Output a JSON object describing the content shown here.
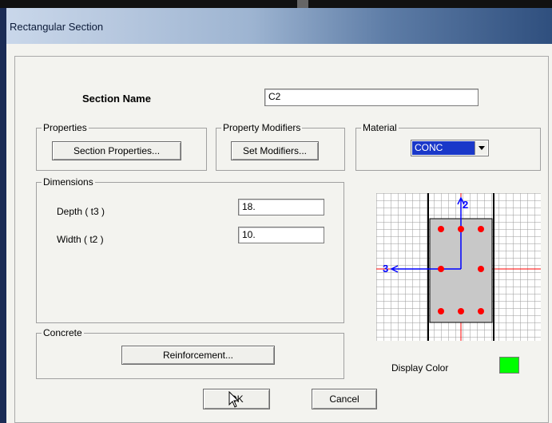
{
  "window": {
    "title": "Rectangular Section"
  },
  "section_name": {
    "label": "Section Name",
    "value": "C2"
  },
  "properties": {
    "legend": "Properties",
    "button": "Section Properties..."
  },
  "modifiers": {
    "legend": "Property Modifiers",
    "button": "Set Modifiers..."
  },
  "material": {
    "legend": "Material",
    "selected": "CONC"
  },
  "dimensions": {
    "legend": "Dimensions",
    "depth_label": "Depth ( t3 )",
    "depth_value": "18.",
    "width_label": "Width ( t2 )",
    "width_value": "10."
  },
  "concrete": {
    "legend": "Concrete",
    "button": "Reinforcement..."
  },
  "preview": {
    "axis2_label": "2",
    "axis3_label": "3",
    "section_color": "#c8c8c8",
    "rebar_color": "#ff0000",
    "axis_color": "#0000ff"
  },
  "display_color": {
    "label": "Display Color",
    "color": "#00ff00"
  },
  "buttons": {
    "ok": "OK",
    "cancel": "Cancel"
  }
}
